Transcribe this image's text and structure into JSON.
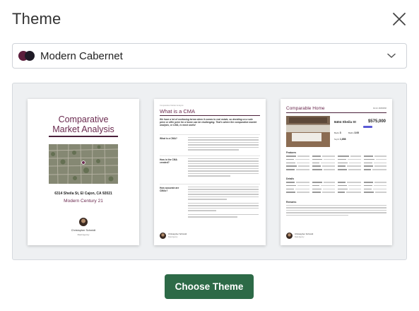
{
  "dialog": {
    "title": "Theme",
    "close_icon": "close-icon"
  },
  "theme_select": {
    "selected": "Modern Cabernet",
    "swatch_colors": [
      "#5c1e3c",
      "#1f1a26"
    ],
    "chevron_icon": "chevron-down-icon"
  },
  "colors": {
    "accent": "#6b2a4f",
    "accent_dark": "#4a1f3a",
    "primary_button": "#2d6a47"
  },
  "preview": {
    "cover": {
      "title_line1": "Comparative",
      "title_line2": "Market Analysis",
      "address": "6314 Sheila St, El Cajon, CA 92021",
      "subtitle": "Modern Century 21",
      "agent_name": "Christopher Schmidt",
      "company": "Real Agency"
    },
    "cma_page": {
      "header": "Comparative Market Analysis",
      "title": "What is a CMA",
      "intro": "We have a lot of confusing terms when it comes to real estate, so deciding on a sale price or offer price for a home can be challenging. That's where the comparative market analysis, or CMA, is most useful",
      "sections": [
        {
          "label": "What is a CMA?"
        },
        {
          "label": "How is the CMA created?"
        },
        {
          "label": "How accurate are CMAs?"
        }
      ],
      "agent_name": "Christopher Schmidt",
      "company": "Real Agency"
    },
    "comparable_page": {
      "title": "Comparable Home",
      "side_label": "MLS# 48888888",
      "address": "8404 Sheila St",
      "price": "$575,000",
      "beds_label": "Beds",
      "beds": "3",
      "baths_label": "Baths",
      "baths": "3.00",
      "sqft_label": "Sq Ft",
      "sqft": "1,858",
      "features_heading": "Features",
      "details_heading": "Details",
      "remarks_heading": "Remarks",
      "agent_name": "Christopher Schmidt",
      "company": "Real Agency"
    }
  },
  "actions": {
    "choose_label": "Choose Theme"
  }
}
